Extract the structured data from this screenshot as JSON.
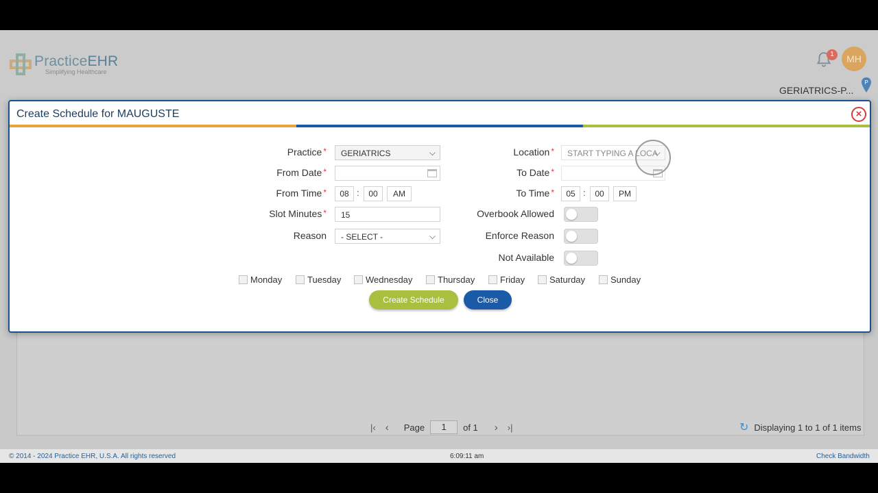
{
  "app": {
    "logo_main": "Practice",
    "logo_bold": "EHR",
    "logo_sub": "Simplifying Healthcare",
    "notification_count": "1",
    "avatar_initials": "MH",
    "practice_short": "GERIATRICS-P...",
    "colors": {
      "accent_blue": "#1a5aa6",
      "accent_green": "#a9bf3f",
      "accent_orange": "#e8a33c"
    }
  },
  "modal": {
    "title": "Create Schedule for MAUGUSTE",
    "close_icon": "close-circle-icon",
    "fields": {
      "practice_label": "Practice",
      "practice_value": "GERIATRICS",
      "from_date_label": "From Date",
      "from_date_value": "",
      "from_time_label": "From Time",
      "from_hour": "08",
      "from_minute": "00",
      "from_ampm": "AM",
      "slot_minutes_label": "Slot Minutes",
      "slot_minutes_value": "15",
      "reason_label": "Reason",
      "reason_value": "- SELECT -",
      "location_label": "Location",
      "location_placeholder": "START TYPING A LOCA",
      "to_date_label": "To Date",
      "to_date_value": "",
      "to_time_label": "To Time",
      "to_hour": "05",
      "to_minute": "00",
      "to_ampm": "PM",
      "overbook_label": "Overbook Allowed",
      "enforce_reason_label": "Enforce Reason",
      "not_available_label": "Not Available",
      "overbook_on": false,
      "enforce_reason_on": false,
      "not_available_on": false
    },
    "days": [
      "Monday",
      "Tuesday",
      "Wednesday",
      "Thursday",
      "Friday",
      "Saturday",
      "Sunday"
    ],
    "buttons": {
      "create": "Create Schedule",
      "close": "Close"
    }
  },
  "pager": {
    "page_label": "Page",
    "page_value": "1",
    "of_label": "of 1",
    "display_text": "Displaying 1 to 1 of 1 items"
  },
  "footer": {
    "copyright": "© 2014 - 2024 Practice EHR, U.S.A. All rights reserved",
    "time": "6:09:11 am",
    "check_bandwidth": "Check Bandwidth"
  }
}
